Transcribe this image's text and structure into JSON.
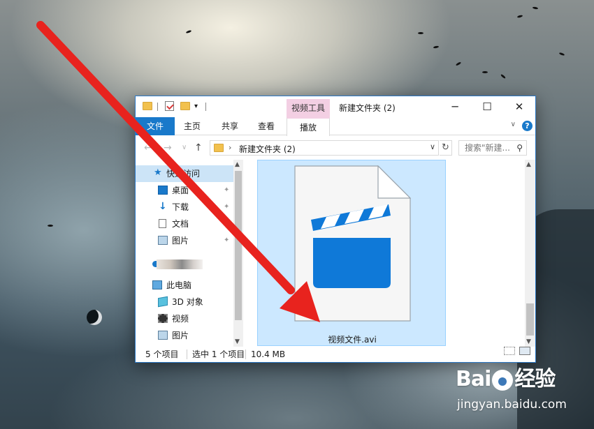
{
  "window": {
    "context_tab": "视频工具",
    "title": "新建文件夹 (2)",
    "controls": {
      "minimize": "─",
      "maximize": "☐",
      "close": "✕"
    }
  },
  "ribbon": {
    "tabs": [
      "文件",
      "主页",
      "共享",
      "查看",
      "播放"
    ],
    "expand_glyph": "∨",
    "help_glyph": "?"
  },
  "address": {
    "back": "←",
    "forward": "→",
    "recent": "∨",
    "up": "↑",
    "separator": "›",
    "path": "新建文件夹 (2)",
    "dropdown": "∨",
    "refresh": "↻",
    "search_placeholder": "搜索\"新建...",
    "search_icon": "⚲"
  },
  "nav": {
    "items": [
      {
        "label": "快速访问",
        "icon": "star-icon",
        "selected": true
      },
      {
        "label": "桌面",
        "icon": "desktop-icon",
        "pinned": true
      },
      {
        "label": "下载",
        "icon": "download-icon",
        "pinned": true
      },
      {
        "label": "文档",
        "icon": "document-icon",
        "pinned": true
      },
      {
        "label": "图片",
        "icon": "pictures-icon",
        "pinned": true
      },
      {
        "label": "",
        "icon": "onedrive-icon"
      },
      {
        "label": "此电脑",
        "icon": "computer-icon"
      },
      {
        "label": "3D 对象",
        "icon": "3d-objects-icon"
      },
      {
        "label": "视频",
        "icon": "video-icon"
      },
      {
        "label": "图片",
        "icon": "pictures-icon"
      }
    ],
    "pin_glyph": "📌"
  },
  "content": {
    "file": {
      "name": "视频文件.avi",
      "icon": "video-file-icon",
      "selected": true
    }
  },
  "status": {
    "item_count": "5 个项目",
    "selected": "选中 1 个项目",
    "size": "10.4 MB"
  },
  "watermark": {
    "logo_left": "Bai",
    "logo_right": "经验",
    "url": "jingyan.baidu.com"
  },
  "colors": {
    "accent": "#1979ca",
    "selection": "#cce8ff",
    "context_tab": "#f3cfe3",
    "arrow": "#e8231e"
  }
}
